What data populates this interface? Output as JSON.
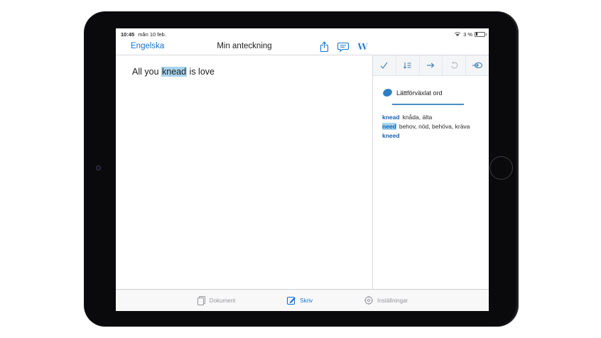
{
  "colors": {
    "accent": "#1673cf",
    "highlight": "#a8d4ec",
    "toolbar_icon": "#4a82b4",
    "disabled_icon": "#babec5",
    "inactive_tab": "#96969c"
  },
  "status_bar": {
    "time": "10:45",
    "date": "mån 10 feb.",
    "battery_percent": "3 %"
  },
  "nav_bar": {
    "back_label": "Engelska",
    "title": "Min anteckning"
  },
  "editor": {
    "text_before": "All you ",
    "highlighted_word": "knead",
    "text_after": " is love"
  },
  "side_panel": {
    "section_title": "Lättförväxlat ord",
    "entries": [
      {
        "word": "knead",
        "translation": "knåda, älta"
      },
      {
        "word": "need",
        "translation": "behov, nöd, behöva, kräva"
      },
      {
        "word": "kneed",
        "translation": ""
      }
    ]
  },
  "tab_bar": {
    "tabs": [
      {
        "label": "Dokument"
      },
      {
        "label": "Skriv"
      },
      {
        "label": "Inställningar"
      }
    ]
  }
}
